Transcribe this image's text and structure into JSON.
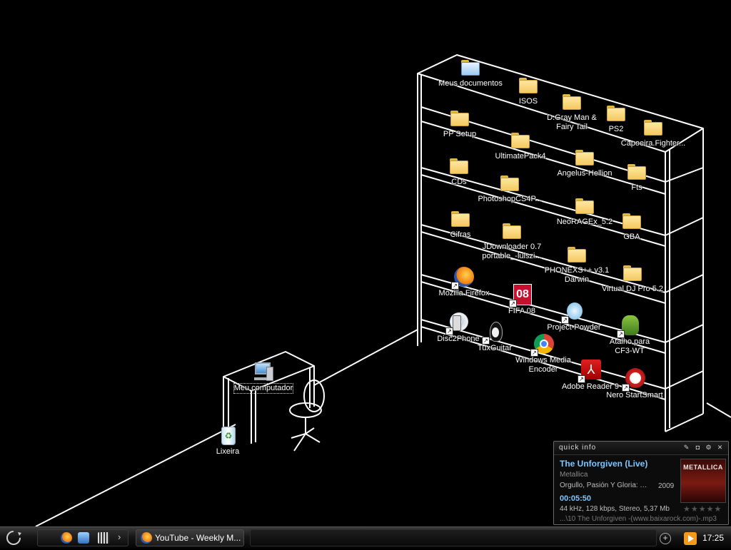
{
  "desktop": {
    "icons": {
      "meus_documentos": "Meus documentos",
      "isos": "ISOS",
      "dgray": "D.Gray Man &\nFairy Tail",
      "ps2": "PS2",
      "capoeira": "Capoeira.Fighter...",
      "pp_setup": "PP Setup",
      "ultimatepack": "UltimatePack4",
      "angelus": "Angelus-Hellion",
      "fts": "Fts",
      "cds": "CDs",
      "photoshop": "PhotoshopCS4P...",
      "neoragex": "NeoRAGEx_5.2",
      "gba": "GBA",
      "cifras": "Cifras",
      "jdownloader": "JDownloader 0.7\nportable_-luiszi...",
      "phonexs": "PHONEXS++ v3.1\nDarwin",
      "virtualdj": "Virtual DJ Pro 5.2",
      "firefox": "Mozilla Firefox",
      "fifa": "FIFA 08",
      "project_powder": "Project-Powder",
      "atalho": "Atalho para\nCF3-WT",
      "disc2phone": "Disc2Phone",
      "tuxguitar": "TuxGuitar",
      "wme": "Windows Media\nEncoder",
      "adobe": "Adobe Reader 9",
      "nero": "Nero StartSmart",
      "meu_computador": "Meu computador",
      "lixeira": "Lixeira"
    },
    "fifa_badge": "08"
  },
  "quick_info": {
    "title": "quick info",
    "song": "The Unforgiven (Live)",
    "artist": "Metallica",
    "album": "Orgullo, Pasión Y Gloria: Tr...",
    "year": "2009",
    "time": "00:05:50",
    "format": "44 kHz, 128 kbps, Stereo, 5,37 Mb",
    "file": "...\\10 The Unforgiven -(www.baixarock.com)-.mp3",
    "art_text": "METALLICA",
    "stars": "★★★★★",
    "rating": 0
  },
  "taskbar": {
    "task_label": "YouTube - Weekly M...",
    "clock": "17:25",
    "ql_more": "›"
  },
  "colors": {
    "background": "#000000",
    "lines": "#ffffff",
    "accent": "#7fc6ff",
    "player_orange": "#f39a1a"
  }
}
